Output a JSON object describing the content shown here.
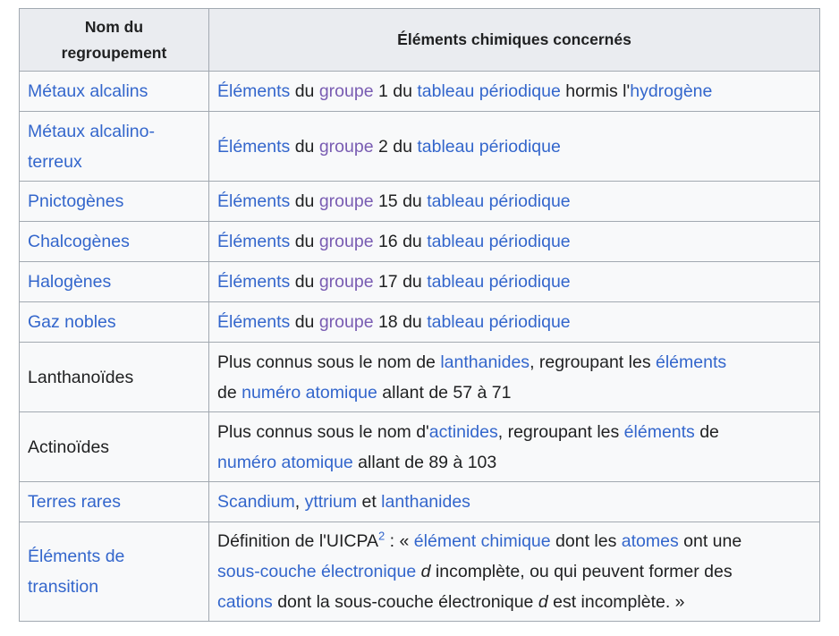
{
  "header": {
    "col1_line1": "Nom du",
    "col1_line2": "regroupement",
    "col2": "Éléments chimiques concernés"
  },
  "common": {
    "elements": "Éléments",
    "du": " du ",
    "groupe": "groupe",
    "du_tableau": " du ",
    "tableau": "tableau périodique"
  },
  "rows": [
    {
      "name": "Métaux alcalins",
      "group_num": " 1",
      "suffix": " hormis l'",
      "suffix_link": "hydrogène"
    },
    {
      "name_line1": "Métaux alcalino-",
      "name_line2": "terreux",
      "group_num": " 2"
    },
    {
      "name": "Pnictogènes",
      "group_num": " 15"
    },
    {
      "name": "Chalcogènes",
      "group_num": " 16"
    },
    {
      "name": "Halogènes",
      "group_num": " 17"
    },
    {
      "name": "Gaz nobles",
      "group_num": " 18"
    },
    {
      "name": "Lanthanoïdes",
      "t1": "Plus connus sous le nom de ",
      "l1": "lanthanides",
      "t2": ", regroupant les ",
      "l2": "éléments",
      "t3": "de ",
      "l3": "numéro atomique",
      "t4": " allant de 57 à 71"
    },
    {
      "name": "Actinoïdes",
      "t1": "Plus connus sous le nom d'",
      "l1": "actinides",
      "t2": ", regroupant les ",
      "l2": "éléments",
      "t3": " de",
      "l3": "numéro atomique",
      "t4": " allant de 89 à 103"
    },
    {
      "name": "Terres rares",
      "l1": "Scandium",
      "t1": ", ",
      "l2": "yttrium",
      "t2": " et ",
      "l3": "lanthanides"
    },
    {
      "name_line1": "Éléments de",
      "name_line2": "transition",
      "t1": "Définition de l'UICPA",
      "sup": "2",
      "t2": " : « ",
      "l1": "élément chimique",
      "t3": " dont les ",
      "l2": "atomes",
      "t4": " ont une",
      "l3": "sous-couche électronique",
      "t5": " ",
      "i1": "d",
      "t6": " incomplète, ou qui peuvent former des",
      "l4": "cations",
      "t7": " dont la sous-couche électronique ",
      "i2": "d",
      "t8": " est incomplète. »"
    }
  ]
}
